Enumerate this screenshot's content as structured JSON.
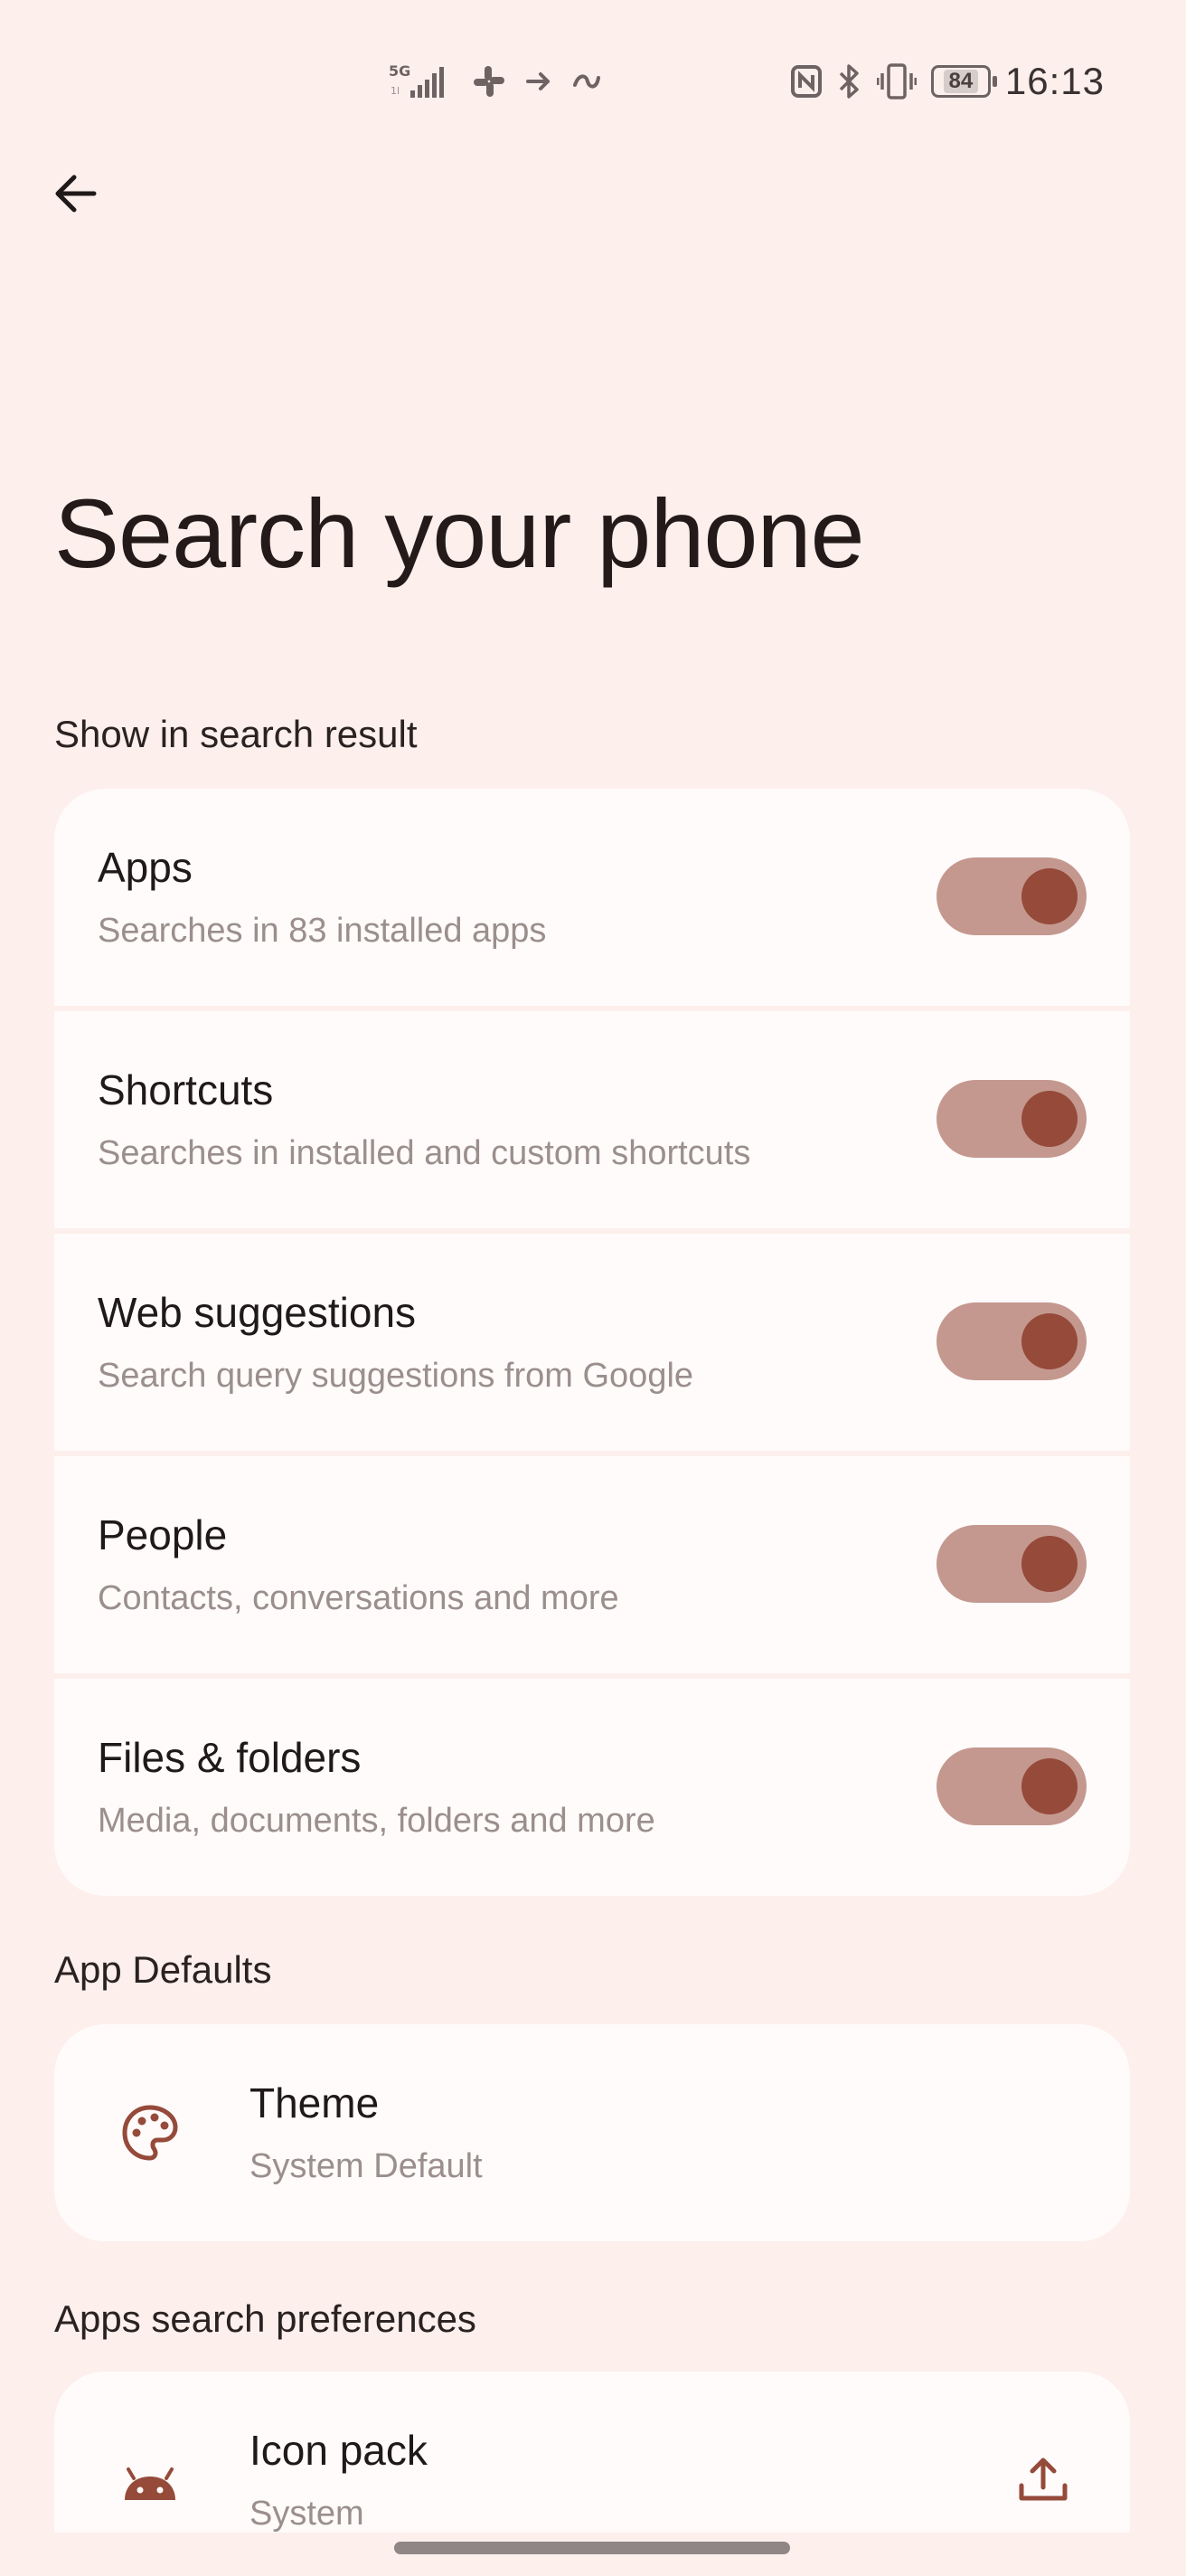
{
  "status_bar": {
    "time": "16:13",
    "battery": "84",
    "left_icons": [
      "5g-signal-icon",
      "slack-icon",
      "forward-arrow-icon",
      "data-saver-icon"
    ],
    "right_icons": [
      "nfc-icon",
      "bluetooth-icon",
      "vibrate-icon",
      "battery-icon"
    ],
    "network_label": "5G"
  },
  "header": {
    "title": "Search your phone"
  },
  "sections": {
    "search_result": {
      "header": "Show in search result",
      "items": [
        {
          "title": "Apps",
          "subtitle": "Searches in 83 installed apps",
          "enabled": true
        },
        {
          "title": "Shortcuts",
          "subtitle": "Searches in installed and custom shortcuts",
          "enabled": true
        },
        {
          "title": "Web suggestions",
          "subtitle": "Search query suggestions from Google",
          "enabled": true
        },
        {
          "title": "People",
          "subtitle": "Contacts, conversations and more",
          "enabled": true
        },
        {
          "title": "Files & folders",
          "subtitle": "Media, documents, folders and more",
          "enabled": true
        }
      ]
    },
    "app_defaults": {
      "header": "App Defaults",
      "items": [
        {
          "title": "Theme",
          "subtitle": "System Default",
          "icon": "palette-icon"
        }
      ]
    },
    "apps_search_preferences": {
      "header": "Apps search preferences",
      "items": [
        {
          "title": "Icon pack",
          "subtitle": "System",
          "icon": "android-icon",
          "trailing_icon": "upload-icon"
        }
      ]
    }
  },
  "colors": {
    "background": "#fcefec",
    "card": "#fffbfa",
    "accent": "#954a3a",
    "toggle_track": "#c4988f"
  }
}
